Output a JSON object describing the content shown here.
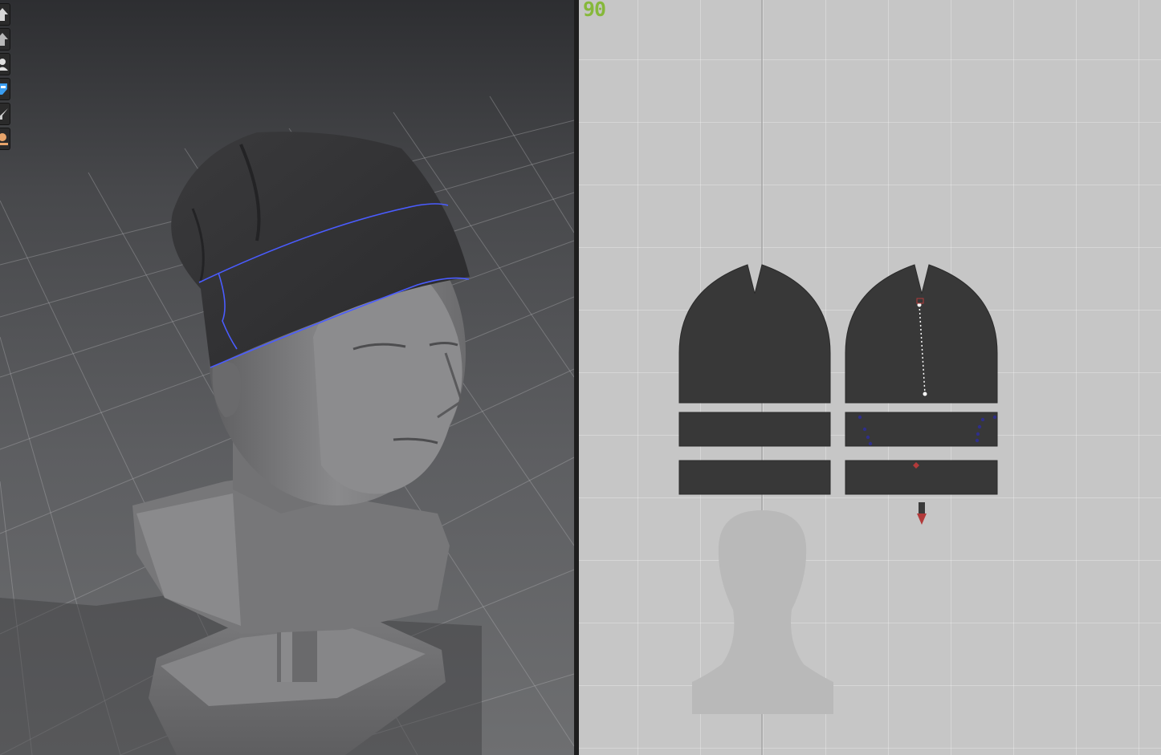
{
  "toolbar": {
    "tools": [
      {
        "icon": "arrow-up-icon"
      },
      {
        "icon": "arrow-up-alt-icon"
      },
      {
        "icon": "avatar-icon"
      },
      {
        "icon": "brush-icon",
        "active": true
      },
      {
        "icon": "needle-icon"
      },
      {
        "icon": "user-head-icon"
      }
    ]
  },
  "view_2d": {
    "zoom_readout": "90"
  },
  "colors": {
    "seam_line": "#4a5cff",
    "pattern_fill": "#383838",
    "zoom_text": "#86b83a",
    "pin_marker": "#b23a3a"
  }
}
